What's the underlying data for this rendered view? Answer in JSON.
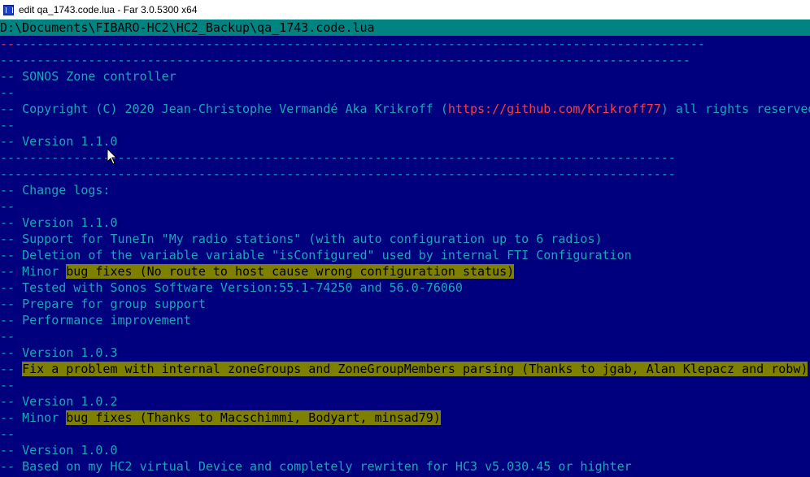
{
  "window": {
    "title": "edit qa_1743.code.lua - Far 3.0.5300 x64"
  },
  "path": "D:\\Documents\\FIBARO-HC2\\HC2_Backup\\qa_1743.code.lua",
  "lines": [
    {
      "prefix": "--",
      "rest": "----------------------------------------------------------------------------------------------"
    },
    {
      "prefix": "",
      "rest": "----------------------------------------------------------------------------------------------"
    },
    {
      "text": "-- SONOS Zone controller"
    },
    {
      "text": "--"
    },
    {
      "text": "-- Copyright (C) 2020 Jean-Christophe Vermandé Aka Krikroff (",
      "url": "https://github.com/Krikroff77",
      "after": ") all rights reserved"
    },
    {
      "text": "--"
    },
    {
      "text": "-- Version 1.1.0"
    },
    {
      "text": "--------------------------------------------------------------------------------------------"
    },
    {
      "text": "--------------------------------------------------------------------------------------------"
    },
    {
      "text": "-- Change logs:"
    },
    {
      "text": "--"
    },
    {
      "text": "-- Version 1.1.0"
    },
    {
      "text": "-- Support for TuneIn \"My radio stations\" (with auto configuration up to 6 radios)"
    },
    {
      "text": "-- Deletion of the variable variable \"isConfigured\" used by internal FTI Configuration"
    },
    {
      "text": "-- Minor ",
      "hl": "bug fixes (No route to host cause wrong configuration status)"
    },
    {
      "text": "-- Tested with Sonos Software Version:55.1-74250 and 56.0-76060"
    },
    {
      "text": "-- Prepare for group support"
    },
    {
      "text": "-- Performance improvement"
    },
    {
      "text": "--"
    },
    {
      "text": "-- Version 1.0.3"
    },
    {
      "text": "-- ",
      "hl": "Fix a problem with internal zoneGroups and ZoneGroupMembers parsing (Thanks to jgab, Alan Klepacz and robw)"
    },
    {
      "text": "--"
    },
    {
      "text": "-- Version 1.0.2"
    },
    {
      "text": "-- Minor ",
      "hl": "bug fixes (Thanks to Macschimmi, Bodyart, minsad79)"
    },
    {
      "text": "--"
    },
    {
      "text": "-- Version 1.0.0"
    },
    {
      "text": "-- Based on my HC2 virtual Device and completely rewriten for HC3 v5.030.45 or highter"
    }
  ]
}
